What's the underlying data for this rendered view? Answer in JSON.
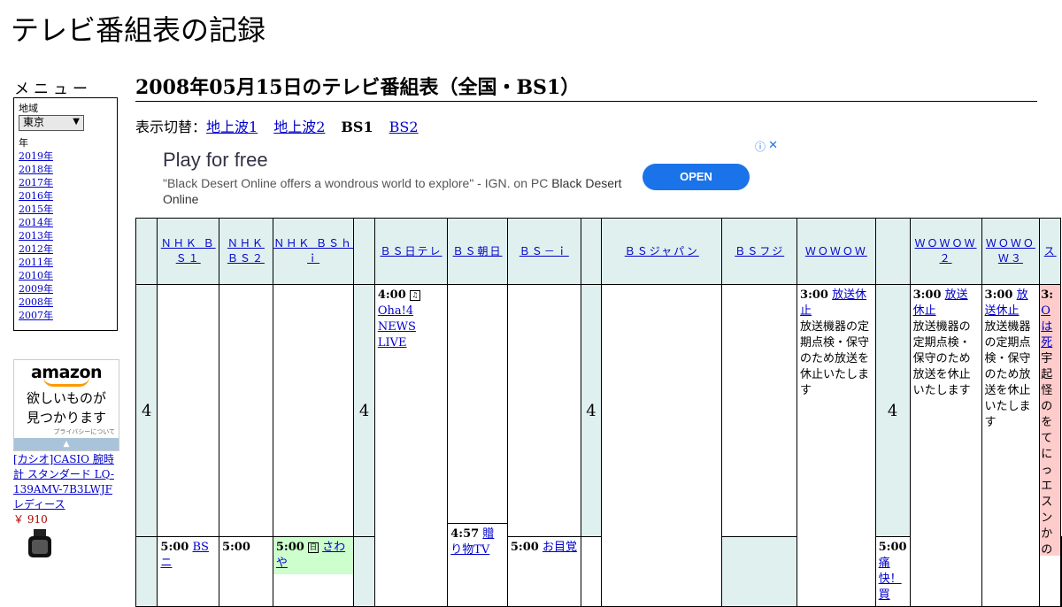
{
  "site_title": "テレビ番組表の記録",
  "menu": {
    "heading": "メニュー",
    "region_label": "地域",
    "region_value": "東京",
    "year_label": "年",
    "years": [
      "2019年",
      "2018年",
      "2017年",
      "2016年",
      "2015年",
      "2014年",
      "2013年",
      "2012年",
      "2011年",
      "2010年",
      "2009年",
      "2008年",
      "2007年"
    ]
  },
  "amazon_ad": {
    "logo": "amazon",
    "tagline_1": "欲しいものが",
    "tagline_2": "見つかります",
    "privacy": "プライバシーについて",
    "product_name": "[カシオ]CASIO 腕時計 スタンダード LQ-139AMV-7B3LWJF レディース",
    "product_price": "￥ 910"
  },
  "page_heading": "2008年05月15日のテレビ番組表（全国・BS1）",
  "view_switch": {
    "label": "表示切替：",
    "options": [
      "地上波1",
      "地上波2",
      "BS1",
      "BS2"
    ],
    "current": "BS1"
  },
  "ad": {
    "title": "Play for free",
    "body": "\"Black Desert Online offers a wondrous world to explore\" - IGN. on PC",
    "body_strong": "Black Desert Online",
    "button": "OPEN"
  },
  "guide": {
    "channels": [
      "ＮＨＫ ＢＳ１",
      "ＮＨＫ ＢＳ２",
      "ＮＨＫ ＢＳｈｉ",
      "ＢＳ日テレ",
      "ＢＳ朝日",
      "ＢＳ－ｉ",
      "ＢＳジャパン",
      "ＢＳフジ",
      "ＷＯＷＯＷ",
      "ＷＯＷＯＷ２",
      "ＷＯＷＯＷ３",
      "ス"
    ],
    "hour": "4",
    "programs": {
      "bsntv_4": {
        "time": "4:00",
        "title": "Oha!4 NEWS LIVE"
      },
      "wowow_3": {
        "time": "3:00",
        "title": "放送休止",
        "desc": "放送機器の定期点検・保守のため放送を休止いたします"
      },
      "wowow2_3": {
        "time": "3:00",
        "title": "放送休止",
        "desc": "放送機器の定期点検・保守のため放送を休止いたします"
      },
      "wowow3_3": {
        "time": "3:00",
        "title": "放送休止",
        "desc": "放送機器の定期点検・保守のため放送を休止いたします"
      },
      "star_3": {
        "time": "3:",
        "title": "O は死",
        "desc": "宇起怪のをてにっエスンかの"
      },
      "bs1_5": {
        "time": "5:00",
        "title": "BSニ"
      },
      "bs2_5": {
        "time": "5:00",
        "title": ""
      },
      "bshi_5": {
        "time": "5:00",
        "title": "さわや"
      },
      "bsasahi_457": {
        "time": "4:57",
        "title": "贈り物TV"
      },
      "bsi_5": {
        "time": "5:00",
        "title": "お目覚"
      },
      "bsfuji_5": {
        "time": "5:00",
        "title": "痛快！買"
      }
    }
  }
}
